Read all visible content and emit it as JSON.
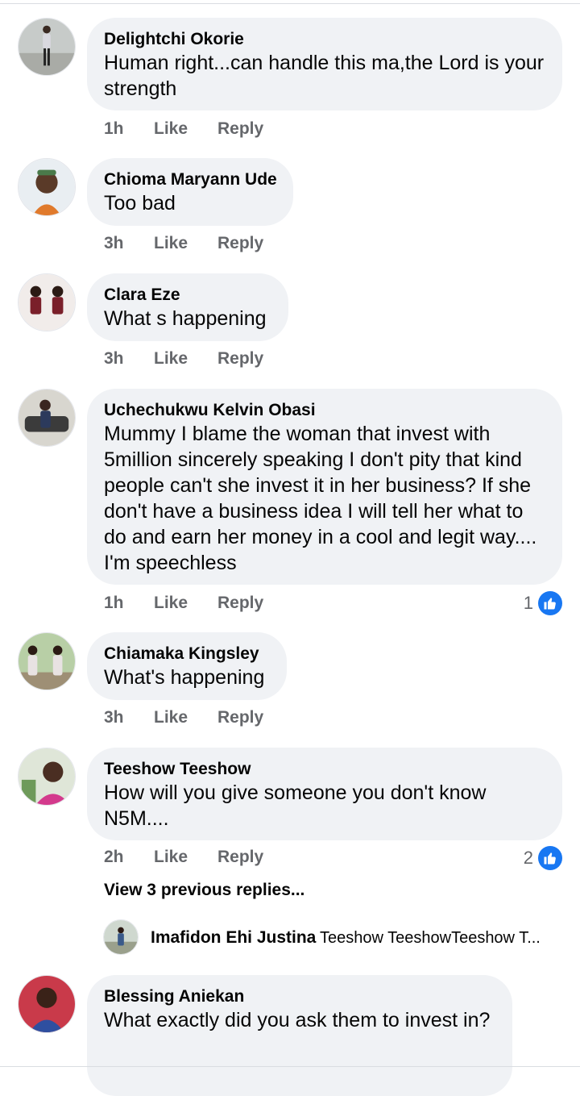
{
  "comments": [
    {
      "author": "Delightchi Okorie",
      "text": "Human right...can handle this ma,the Lord is your strength",
      "time": "1h",
      "like_label": "Like",
      "reply_label": "Reply"
    },
    {
      "author": "Chioma Maryann Ude",
      "text": "Too bad",
      "time": "3h",
      "like_label": "Like",
      "reply_label": "Reply"
    },
    {
      "author": "Clara Eze",
      "text": "What s happening",
      "time": "3h",
      "like_label": "Like",
      "reply_label": "Reply"
    },
    {
      "author": "Uchechukwu Kelvin Obasi",
      "text": "Mummy I blame the woman that invest with 5million sincerely speaking I don't pity that kind people can't she invest it in her business? If she don't have a business idea I will tell her what to do and earn her money in a cool and legit way.... I'm speechless",
      "time": "1h",
      "like_label": "Like",
      "reply_label": "Reply",
      "reaction_count": "1"
    },
    {
      "author": "Chiamaka Kingsley",
      "text": "What's happening",
      "time": "3h",
      "like_label": "Like",
      "reply_label": "Reply"
    },
    {
      "author": "Teeshow Teeshow",
      "text": "How will you give someone you don't know N5M....",
      "time": "2h",
      "like_label": "Like",
      "reply_label": "Reply",
      "reaction_count": "2"
    },
    {
      "author": "Blessing Aniekan",
      "text": "What exactly did you ask them to invest in?"
    }
  ],
  "view_previous_replies": "View 3 previous replies...",
  "reply_preview": {
    "author": "Imafidon Ehi Justina",
    "text": "Teeshow TeeshowTeeshow T..."
  },
  "colors": {
    "bubble": "#f0f2f5",
    "meta_text": "#65676b",
    "like_blue": "#1877f2"
  }
}
